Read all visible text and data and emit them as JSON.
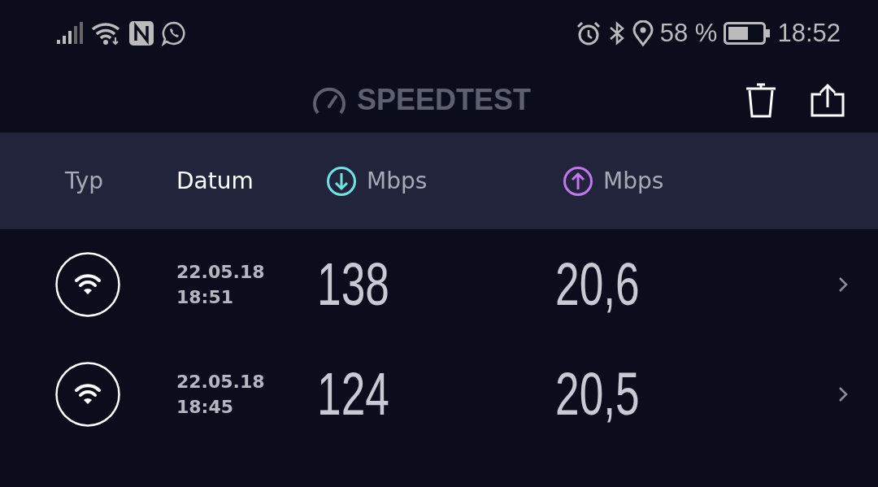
{
  "status_bar": {
    "battery": "58 %",
    "time": "18:52"
  },
  "app_bar": {
    "title": "SPEEDTEST"
  },
  "columns": [
    {
      "label": "Typ",
      "kind": "text",
      "selected": false
    },
    {
      "label": "Datum",
      "kind": "text",
      "selected": true
    },
    {
      "label": "Mbps",
      "kind": "download",
      "selected": false
    },
    {
      "label": "Mbps",
      "kind": "upload",
      "selected": false
    }
  ],
  "rows": [
    {
      "kind": "wifi",
      "date": "22.05.18",
      "time": "18:51",
      "download": "138",
      "upload": "20,6"
    },
    {
      "kind": "wifi",
      "date": "22.05.18",
      "time": "18:45",
      "download": "124",
      "upload": "20,5"
    }
  ]
}
